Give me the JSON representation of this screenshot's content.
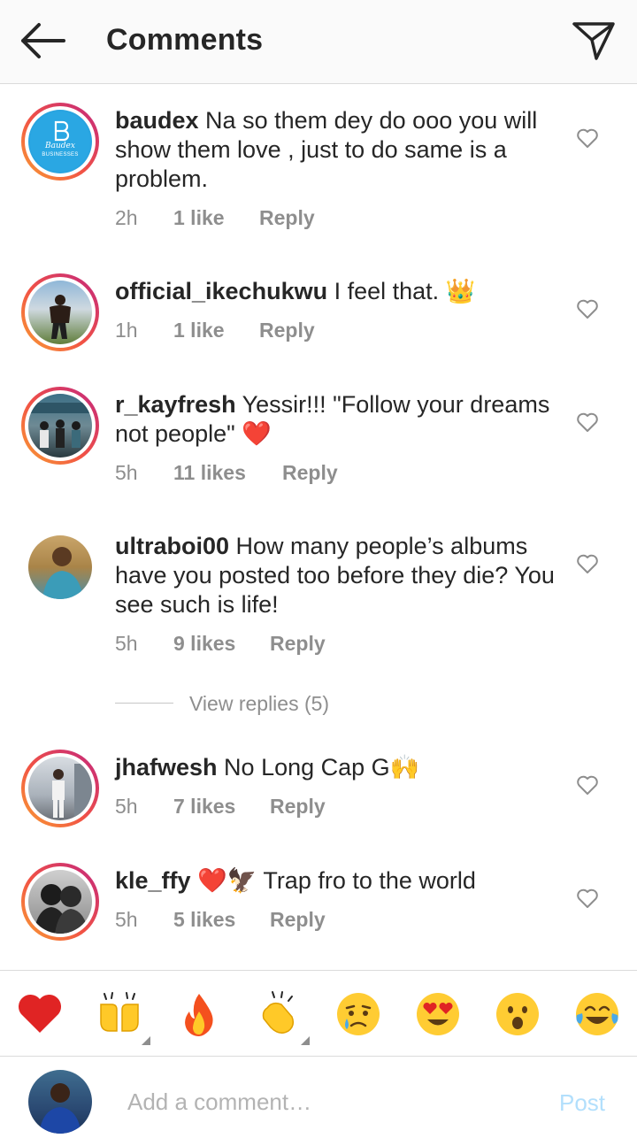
{
  "header": {
    "title": "Comments"
  },
  "comments": [
    {
      "username": "baudex",
      "text": "Na so them dey do ooo you will show them love , just to do same is a problem.",
      "time": "2h",
      "likes": "1 like",
      "reply": "Reply"
    },
    {
      "username": "official_ikechukwu",
      "text": "I feel that. 👑",
      "time": "1h",
      "likes": "1 like",
      "reply": "Reply"
    },
    {
      "username": "r_kayfresh",
      "text": "Yessir!!! \"Follow your dreams not people\" ❤️",
      "time": "5h",
      "likes": "11 likes",
      "reply": "Reply"
    },
    {
      "username": "ultraboi00",
      "text": "How many people’s albums have you posted too before they die? You see such is life!",
      "time": "5h",
      "likes": "9 likes",
      "reply": "Reply"
    },
    {
      "username": "jhafwesh",
      "text": "No Long Cap G🙌",
      "time": "5h",
      "likes": "7 likes",
      "reply": "Reply"
    },
    {
      "username": "kle_ffy",
      "text": "❤️🦅 Trap fro to the world",
      "time": "5h",
      "likes": "5 likes",
      "reply": "Reply"
    }
  ],
  "view_replies": "View replies (5)",
  "avatar_badge": {
    "script": "Baudex",
    "label": "BUSINESSES"
  },
  "emoji_bar": [
    {
      "name": "heart",
      "glyph": "❤️"
    },
    {
      "name": "raising-hands",
      "glyph": "🙌"
    },
    {
      "name": "fire",
      "glyph": "🔥"
    },
    {
      "name": "clapping-hands",
      "glyph": "👏"
    },
    {
      "name": "crying-face",
      "glyph": "😢"
    },
    {
      "name": "heart-eyes",
      "glyph": "😍"
    },
    {
      "name": "surprised-face",
      "glyph": "😮"
    },
    {
      "name": "tears-of-joy",
      "glyph": "😂"
    }
  ],
  "input": {
    "placeholder": "Add a comment…",
    "post_label": "Post"
  },
  "colors": {
    "ring_start": "#f9a033",
    "ring_end": "#c2267f",
    "post": "#b2dffc",
    "muted": "#8e8e8e"
  }
}
